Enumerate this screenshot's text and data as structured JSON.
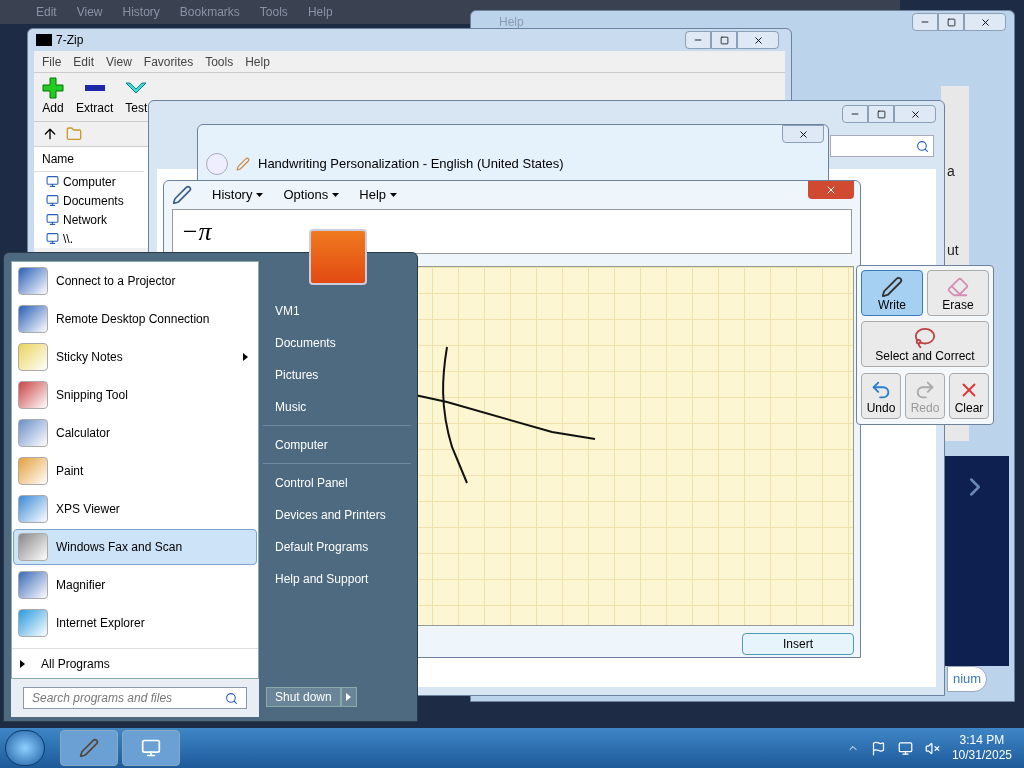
{
  "browser_window": {
    "menu": [
      "Edit",
      "View",
      "History",
      "Bookmarks",
      "Tools",
      "Help"
    ]
  },
  "help_window": {
    "title": "Help",
    "fragments": [
      "a",
      "ut"
    ],
    "button": "nium"
  },
  "zip_window": {
    "title": "7-Zip",
    "menu": [
      "File",
      "Edit",
      "View",
      "Favorites",
      "Tools",
      "Help"
    ],
    "toolbar": [
      {
        "label": "Add",
        "kind": "add"
      },
      {
        "label": "Extract",
        "kind": "extract"
      },
      {
        "label": "Test",
        "kind": "test"
      }
    ],
    "column": "Name",
    "items": [
      "Computer",
      "Documents",
      "Network",
      "\\\\."
    ]
  },
  "handwriting_window": {
    "title": "Handwriting Personalization - English (United States)"
  },
  "math_input": {
    "menu": [
      "History",
      "Options",
      "Help"
    ],
    "preview": "−π",
    "tools": [
      {
        "label": "Write",
        "kind": "write",
        "selected": true,
        "disabled": false
      },
      {
        "label": "Erase",
        "kind": "erase",
        "selected": false,
        "disabled": false
      },
      {
        "label": "Select and Correct",
        "kind": "select",
        "selected": false,
        "disabled": false
      },
      {
        "label": "Undo",
        "kind": "undo",
        "selected": false,
        "disabled": false
      },
      {
        "label": "Redo",
        "kind": "redo",
        "selected": false,
        "disabled": true
      },
      {
        "label": "Clear",
        "kind": "clear",
        "selected": false,
        "disabled": false
      }
    ],
    "insert": "Insert"
  },
  "start_menu": {
    "programs": [
      {
        "label": "Connect to a Projector",
        "selected": false,
        "submenu": false
      },
      {
        "label": "Remote Desktop Connection",
        "selected": false,
        "submenu": false
      },
      {
        "label": "Sticky Notes",
        "selected": false,
        "submenu": true
      },
      {
        "label": "Snipping Tool",
        "selected": false,
        "submenu": false
      },
      {
        "label": "Calculator",
        "selected": false,
        "submenu": false
      },
      {
        "label": "Paint",
        "selected": false,
        "submenu": false
      },
      {
        "label": "XPS Viewer",
        "selected": false,
        "submenu": false
      },
      {
        "label": "Windows Fax and Scan",
        "selected": true,
        "submenu": false
      },
      {
        "label": "Magnifier",
        "selected": false,
        "submenu": false
      },
      {
        "label": "Internet Explorer",
        "selected": false,
        "submenu": false
      }
    ],
    "all_programs": "All Programs",
    "search": {
      "placeholder": "Search programs and files"
    },
    "places": [
      {
        "label": "VM1",
        "separator_before": false
      },
      {
        "label": "Documents",
        "separator_before": false
      },
      {
        "label": "Pictures",
        "separator_before": false
      },
      {
        "label": "Music",
        "separator_before": false
      },
      {
        "label": "Computer",
        "separator_before": true
      },
      {
        "label": "Control Panel",
        "separator_before": true
      },
      {
        "label": "Devices and Printers",
        "separator_before": false
      },
      {
        "label": "Default Programs",
        "separator_before": false
      },
      {
        "label": "Help and Support",
        "separator_before": false
      }
    ],
    "shut_down": "Shut down"
  },
  "taskbar": {
    "time": "3:14 PM",
    "date": "10/31/2025"
  }
}
